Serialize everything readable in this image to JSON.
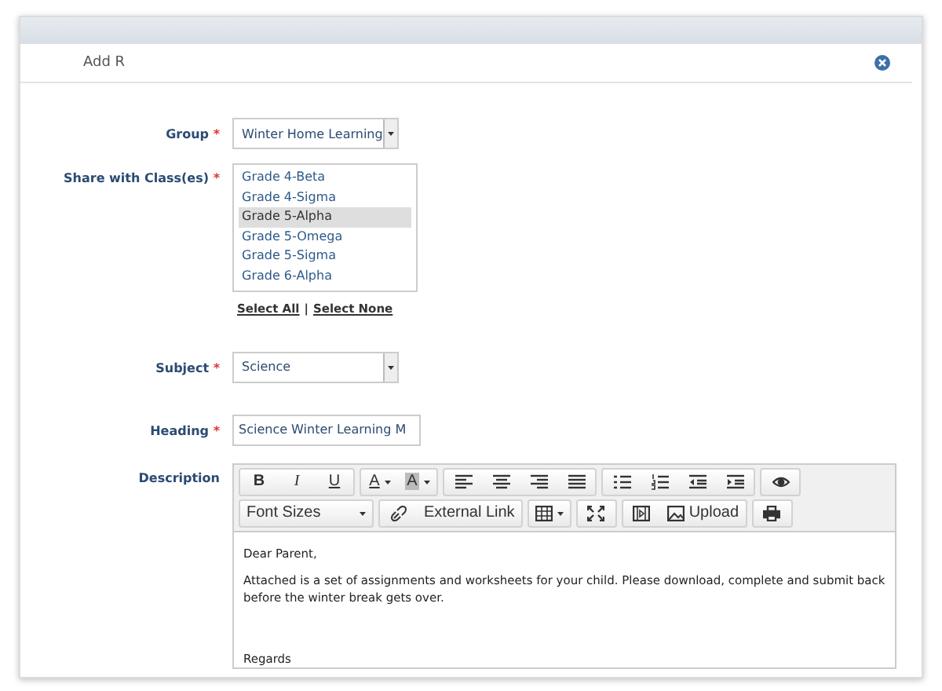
{
  "dialog": {
    "title": "Add R"
  },
  "form": {
    "group": {
      "label": "Group",
      "mark": "*",
      "value": "Winter Home Learning"
    },
    "classes": {
      "label": "Share with Class(es)",
      "mark": "*",
      "options": [
        {
          "label": "Grade 4-Beta",
          "selected": false
        },
        {
          "label": "Grade 4-Sigma",
          "selected": false
        },
        {
          "label": "Grade 5-Alpha",
          "selected": true
        },
        {
          "label": "Grade 5-Omega",
          "selected": false
        },
        {
          "label": "Grade 5-Sigma",
          "selected": false
        },
        {
          "label": "Grade 6-Alpha",
          "selected": false
        }
      ],
      "links": [
        "Select All",
        "Select None"
      ],
      "separator": "|"
    },
    "subject": {
      "label": "Subject",
      "mark": "*",
      "value": "Science"
    },
    "heading": {
      "label": "Heading",
      "mark": "*",
      "value": "Science Winter Learning M"
    },
    "description": {
      "label": "Description",
      "toolbar": [
        [
          [
            {
              "kind": "bold",
              "label": "B"
            },
            {
              "kind": "italic",
              "label": "I"
            },
            {
              "kind": "underline",
              "label": "U"
            }
          ],
          [
            {
              "kind": "forecolor",
              "label": "A"
            },
            {
              "kind": "backcolor",
              "label": "A"
            }
          ],
          [
            {
              "kind": "alignleft"
            },
            {
              "kind": "aligncenter"
            },
            {
              "kind": "alignright"
            },
            {
              "kind": "justify"
            }
          ],
          [
            {
              "kind": "bullets"
            },
            {
              "kind": "numbers"
            },
            {
              "kind": "outdent"
            },
            {
              "kind": "indent"
            }
          ],
          [
            {
              "kind": "preview"
            }
          ]
        ],
        [
          [
            {
              "kind": "dropdown",
              "label": "Font Sizes"
            }
          ],
          [
            {
              "kind": "link"
            },
            {
              "kind": "text",
              "label": "External Link"
            }
          ],
          [
            {
              "kind": "table"
            }
          ],
          [
            {
              "kind": "fullscreen"
            }
          ],
          [
            {
              "kind": "media"
            },
            {
              "kind": "image",
              "label": "Upload"
            }
          ],
          [
            {
              "kind": "print"
            }
          ]
        ]
      ],
      "paragraphs": [
        "Dear Parent,",
        "Attached is a set of assignments and worksheets for your child. Please download, complete and submit back before the winter break gets over.",
        "Regards"
      ]
    }
  }
}
